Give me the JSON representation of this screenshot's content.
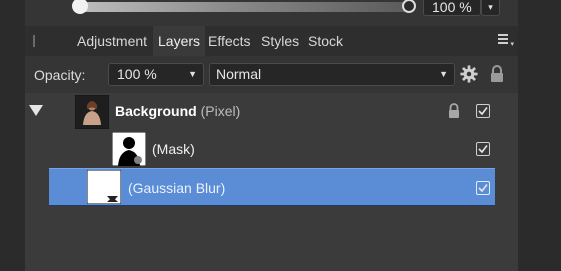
{
  "slider": {
    "percent_label": "100 %",
    "dropdown_caret": "▾"
  },
  "tabs": [
    {
      "label": "Adjustment",
      "active": false
    },
    {
      "label": "Layers",
      "active": true
    },
    {
      "label": "Effects",
      "active": false
    },
    {
      "label": "Styles",
      "active": false
    },
    {
      "label": "Stock",
      "active": false
    }
  ],
  "opacity": {
    "label": "Opacity:",
    "value": "100 %",
    "blend_mode": "Normal"
  },
  "layers": [
    {
      "name": "Background",
      "type": "(Pixel)",
      "locked": true,
      "visible": true,
      "expanded": true,
      "thumbnail_icon": "photo-thumbnail-icon"
    },
    {
      "name": "(Mask)",
      "visible": true,
      "thumbnail_icon": "mask-thumbnail-icon"
    },
    {
      "name": "(Gaussian Blur)",
      "visible": true,
      "selected": true,
      "thumbnail_icon": "blur-thumbnail-icon"
    }
  ],
  "colors": {
    "selection": "#5b8cd6",
    "panel": "#353535",
    "list": "#3b3b3b"
  }
}
